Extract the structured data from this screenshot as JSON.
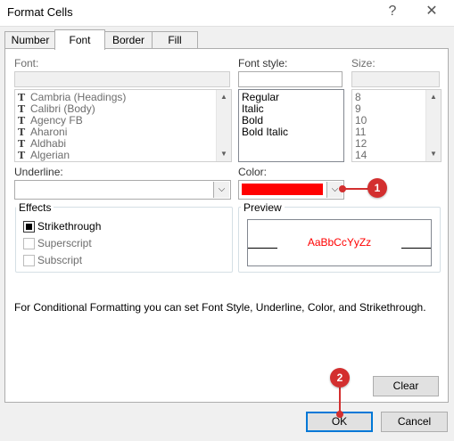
{
  "window": {
    "title": "Format Cells",
    "help_glyph": "?",
    "close_glyph": "✕"
  },
  "tabs": [
    {
      "label": "Number"
    },
    {
      "label": "Font"
    },
    {
      "label": "Border"
    },
    {
      "label": "Fill"
    }
  ],
  "font": {
    "label": "Font:",
    "value": "",
    "items": [
      "Cambria (Headings)",
      "Calibri (Body)",
      "Agency FB",
      "Aharoni",
      "Aldhabi",
      "Algerian"
    ]
  },
  "font_style": {
    "label": "Font style:",
    "value": "",
    "items": [
      "Regular",
      "Italic",
      "Bold",
      "Bold Italic"
    ]
  },
  "size": {
    "label": "Size:",
    "value": "",
    "items": [
      "8",
      "9",
      "10",
      "11",
      "12",
      "14"
    ]
  },
  "underline": {
    "label": "Underline:",
    "value": ""
  },
  "color": {
    "label": "Color:",
    "swatch_color": "#ff0000"
  },
  "effects": {
    "title": "Effects",
    "strikethrough": {
      "label": "Strikethrough",
      "checked": true
    },
    "superscript": {
      "label": "Superscript",
      "checked": false
    },
    "subscript": {
      "label": "Subscript",
      "checked": false
    }
  },
  "preview": {
    "title": "Preview",
    "sample": "AaBbCcYyZz",
    "sample_color": "#ff0000"
  },
  "info_text": "For Conditional Formatting you can set Font Style, Underline, Color, and Strikethrough.",
  "buttons": {
    "clear": "Clear",
    "ok": "OK",
    "cancel": "Cancel"
  },
  "callouts": {
    "one": "1",
    "two": "2",
    "color": "#d32f2f"
  }
}
